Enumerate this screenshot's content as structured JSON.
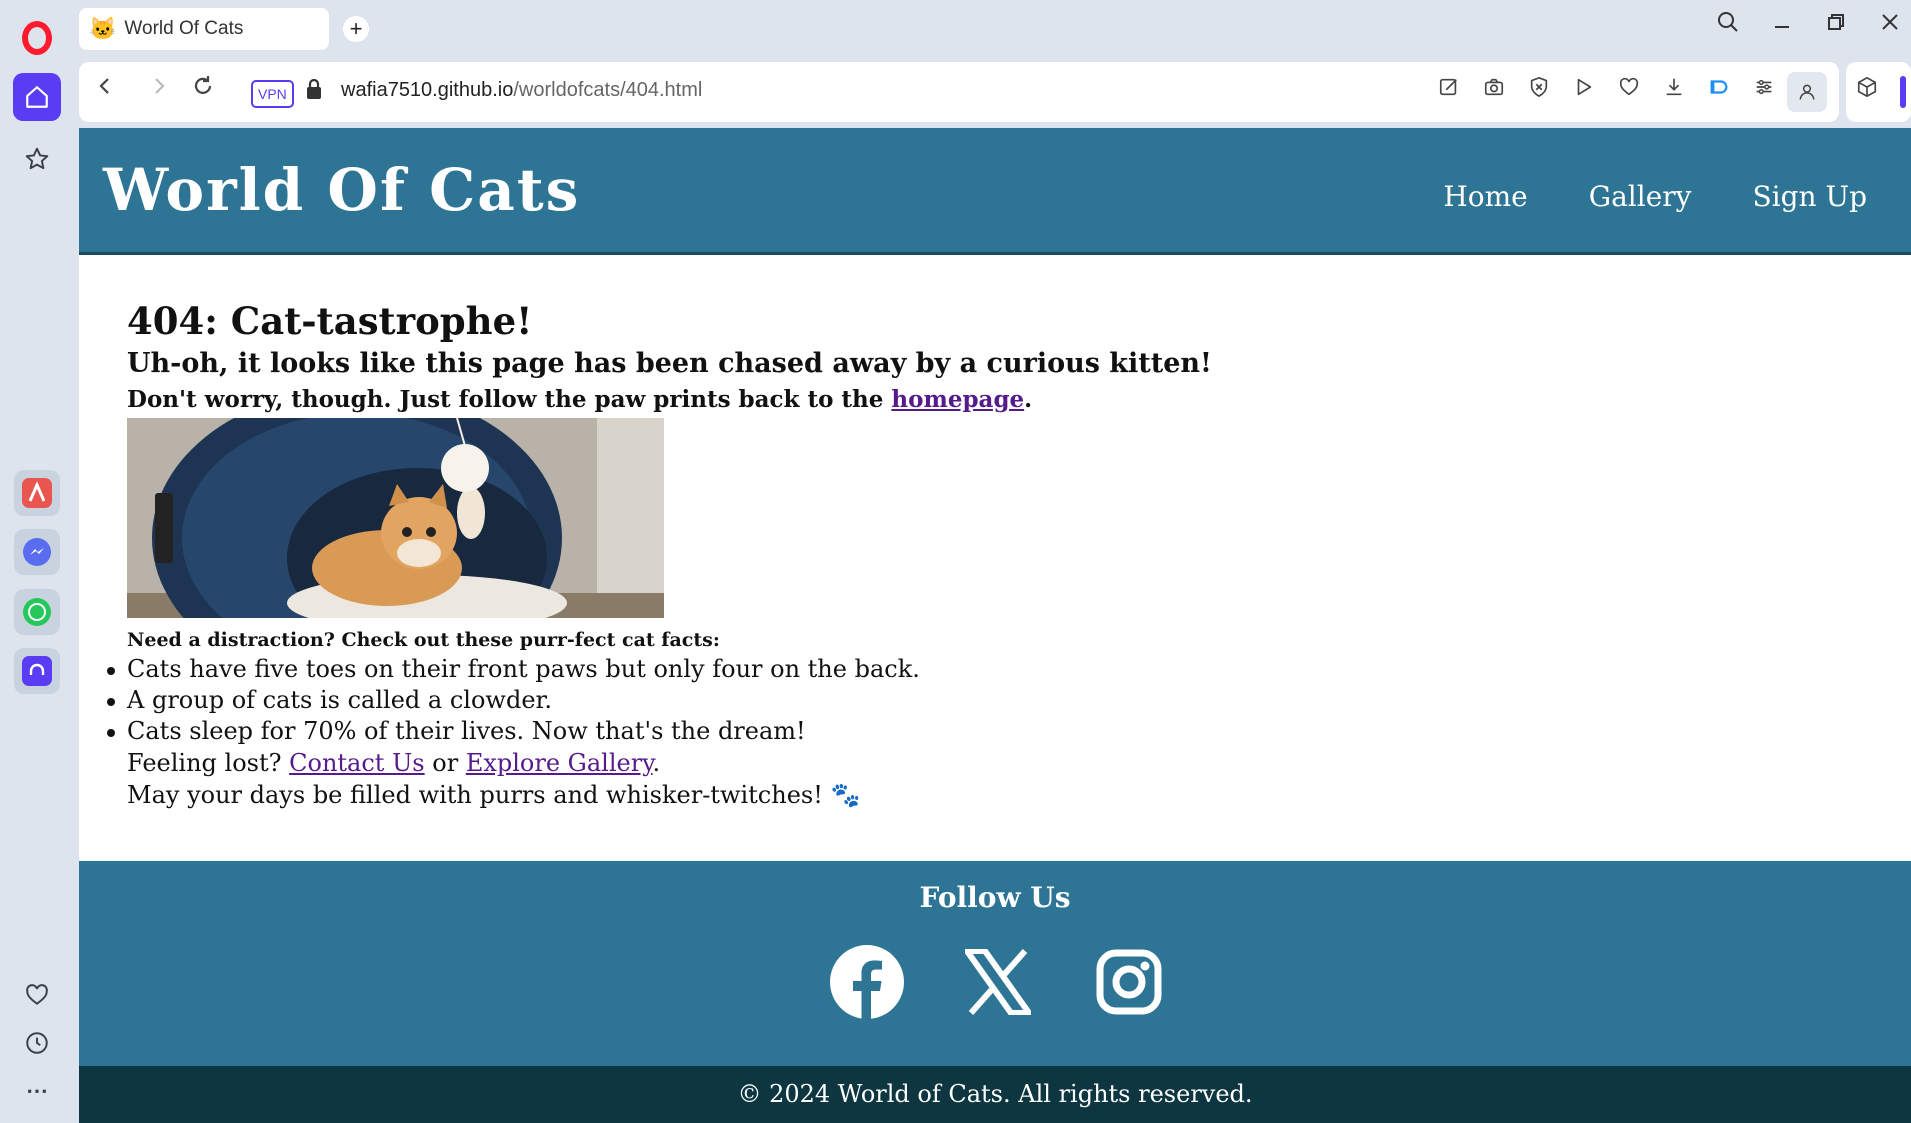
{
  "browser": {
    "tab": {
      "favicon": "cat-face-emoji",
      "title": "World Of Cats"
    },
    "new_tab_label": "+",
    "url": {
      "host": "wafia7510.github.io",
      "path": "/worldofcats/404.html"
    },
    "vpn_label": "VPN"
  },
  "site": {
    "title": "World Of Cats",
    "nav": [
      "Home",
      "Gallery",
      "Sign Up"
    ]
  },
  "content": {
    "heading": "404: Cat-tastrophe!",
    "subheading": "Uh-oh, it looks like this page has been chased away by a curious kitten!",
    "tagline_prefix": "Don't worry, though. Just follow the paw prints back to the ",
    "tagline_link": "homepage",
    "tagline_suffix": ".",
    "facts_title": "Need a distraction? Check out these purr-fect cat facts:",
    "facts": [
      "Cats have five toes on their front paws but only four on the back.",
      "A group of cats is called a clowder.",
      "Cats sleep for 70% of their lives. Now that's the dream!"
    ],
    "lost_prefix": "Feeling lost? ",
    "contact_link": "Contact Us",
    "lost_mid": " or ",
    "gallery_link": "Explore Gallery",
    "lost_suffix": ".",
    "closing": "May your days be filled with purrs and whisker-twitches! 🐾"
  },
  "footer": {
    "follow_title": "Follow Us",
    "social": [
      "facebook-icon",
      "x-icon",
      "instagram-icon"
    ],
    "copyright": "© 2024 World of Cats. All rights reserved."
  },
  "colors": {
    "header_bg": "#2e7595",
    "copyright_bg": "#0d3640",
    "link": "#551a8b",
    "opera_accent": "#5b3cf5"
  }
}
